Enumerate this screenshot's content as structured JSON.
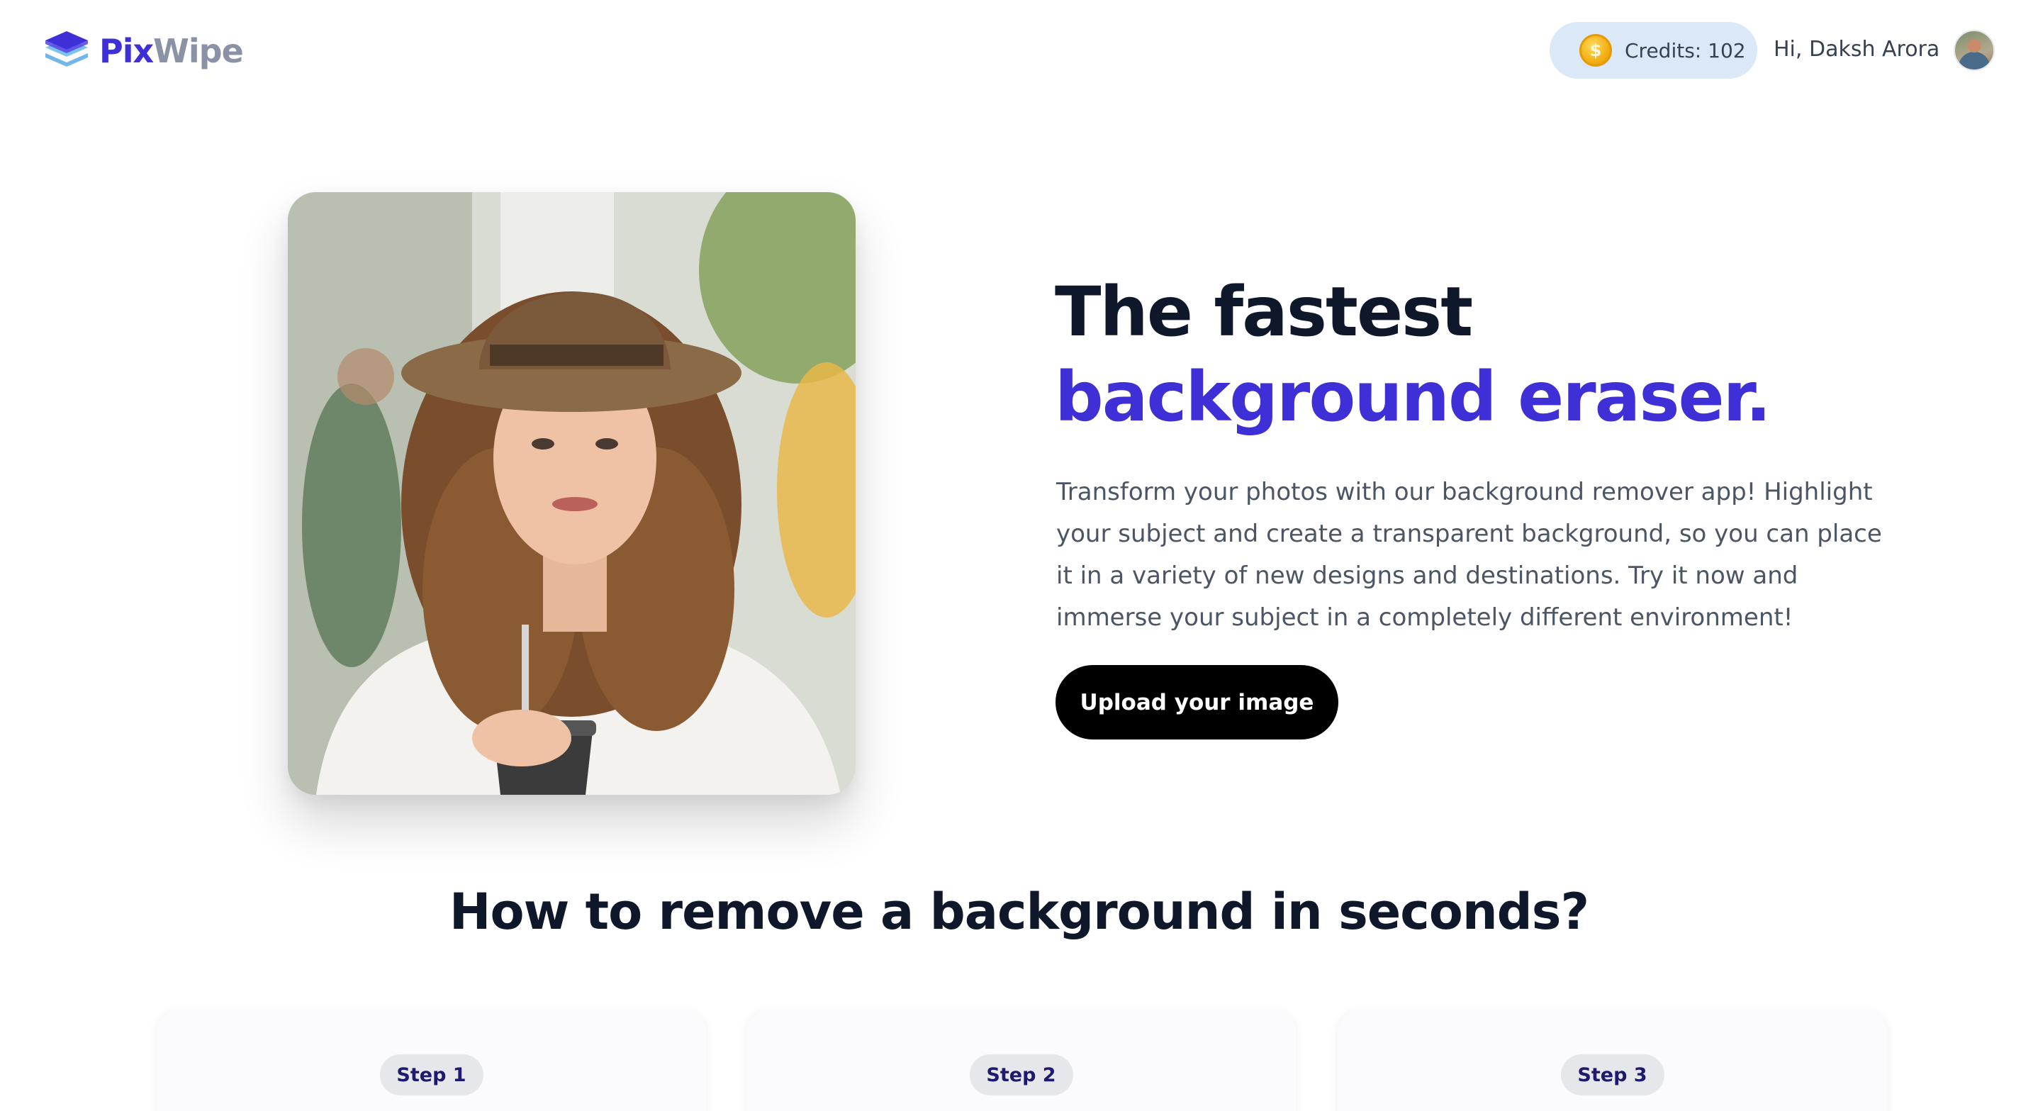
{
  "header": {
    "logo": {
      "part1": "Pix",
      "part2": "Wipe"
    },
    "credits_label": "Credits: 102",
    "greeting": "Hi, Daksh Arora"
  },
  "hero": {
    "title_part1": "The fastest ",
    "title_accent": "background eraser.",
    "description": "Transform your photos with our background remover app! Highlight your subject and create a transparent background, so you can place it in a variety of new designs and destinations. Try it now and immerse your subject in a completely different environment!",
    "upload_button": "Upload your image"
  },
  "how_to": {
    "title": "How to remove a background in seconds?",
    "steps": [
      {
        "label": "Step 1"
      },
      {
        "label": "Step 2"
      },
      {
        "label": "Step 3"
      }
    ]
  },
  "colors": {
    "brand": "#3f2fd6",
    "logo_secondary": "#8a93a6",
    "credits_bg": "#dbe8f8",
    "button_bg": "#000000"
  },
  "icons": {
    "logo": "layers-icon",
    "credits": "coin-icon"
  }
}
